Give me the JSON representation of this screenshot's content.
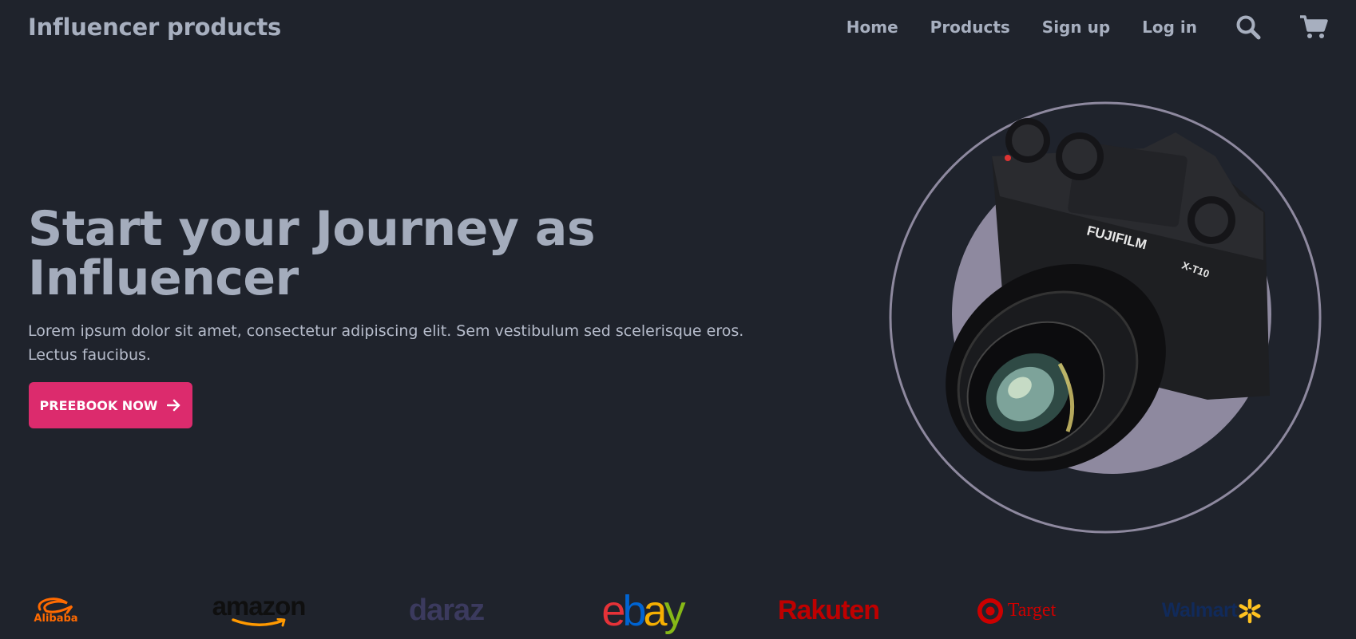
{
  "header": {
    "brand": "Influencer products",
    "nav": [
      {
        "label": "Home"
      },
      {
        "label": "Products"
      },
      {
        "label": "Sign up"
      },
      {
        "label": "Log in"
      }
    ],
    "icons": [
      "search-icon",
      "cart-icon"
    ]
  },
  "hero": {
    "title_line1": "Start your Journey as",
    "title_line2": "Influencer",
    "description": "Lorem ipsum dolor sit amet, consectetur adipiscing elit. Sem vestibulum sed scelerisque eros. Lectus faucibus.",
    "cta_label": "PREEBOOK NOW",
    "cta_icon": "arrow-right-icon",
    "image": {
      "subject": "camera",
      "brand_text": "FUJIFILM",
      "model_text": "X-T10"
    }
  },
  "partners": [
    {
      "name": "Alibaba",
      "label": "Alibaba",
      "color": "#ff6a00"
    },
    {
      "name": "Amazon",
      "label": "amazon",
      "color": "#ff9900"
    },
    {
      "name": "Daraz",
      "label": "daraz",
      "color": "#3b3a5e"
    },
    {
      "name": "eBay",
      "label": "ebay",
      "colors": [
        "#e53238",
        "#0064d2",
        "#f5af02",
        "#86b817"
      ]
    },
    {
      "name": "Rakuten",
      "label": "Rakuten",
      "color": "#bf0000"
    },
    {
      "name": "Target",
      "label": "Target",
      "color": "#cc0000"
    },
    {
      "name": "Walmart",
      "label": "Walmart",
      "color": "#112a5a",
      "accent": "#ffc220"
    }
  ],
  "colors": {
    "background": "#1f232c",
    "text": "#a7afbf",
    "accent": "#dc2b6d",
    "circle": "#8e899f"
  }
}
